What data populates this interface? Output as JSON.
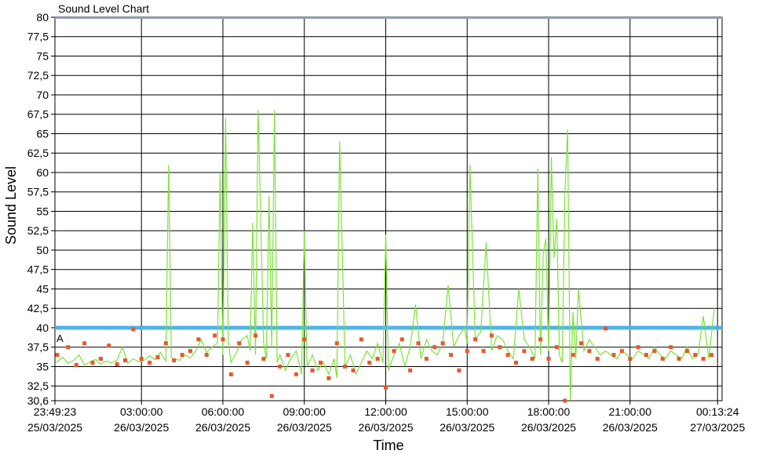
{
  "chart_data": {
    "type": "line",
    "title": "Sound Level Chart",
    "xlabel": "Time",
    "ylabel": "Sound Level",
    "ylim": [
      30.6,
      80
    ],
    "yticks": [
      80,
      77.5,
      75,
      72.5,
      70,
      67.5,
      65,
      62.5,
      60,
      57.5,
      55,
      52.5,
      50,
      47.5,
      45,
      42.5,
      40,
      37.5,
      35,
      32.5,
      30.6
    ],
    "ytick_labels": [
      "80",
      "77,5",
      "75",
      "72,5",
      "70",
      "67,5",
      "65",
      "62,5",
      "60",
      "57,5",
      "55",
      "52,5",
      "50",
      "47,5",
      "45",
      "42,5",
      "40",
      "37,5",
      "35",
      "32,5",
      "30,6"
    ],
    "xlim_hours": [
      -0.18694,
      24.39
    ],
    "xticks": [
      {
        "h": -0.18694,
        "time": "23:49:23",
        "date": "25/03/2025"
      },
      {
        "h": 3,
        "time": "03:00:00",
        "date": "26/03/2025"
      },
      {
        "h": 6,
        "time": "06:00:00",
        "date": "26/03/2025"
      },
      {
        "h": 9,
        "time": "09:00:00",
        "date": "26/03/2025"
      },
      {
        "h": 12,
        "time": "12:00:00",
        "date": "26/03/2025"
      },
      {
        "h": 15,
        "time": "15:00:00",
        "date": "26/03/2025"
      },
      {
        "h": 18,
        "time": "18:00:00",
        "date": "26/03/2025"
      },
      {
        "h": 21,
        "time": "21:00:00",
        "date": "26/03/2025"
      },
      {
        "h": 24.2233,
        "time": "00:13:24",
        "date": "27/03/2025"
      }
    ],
    "threshold": {
      "value": 40,
      "color": "#4fb3ea"
    },
    "marker_label": "A",
    "grid": true,
    "series": [
      {
        "color": "#7de33a",
        "x_hours": [
          -0.15,
          0.1,
          0.3,
          0.5,
          0.7,
          0.9,
          1.1,
          1.3,
          1.5,
          1.7,
          1.9,
          2.1,
          2.3,
          2.5,
          2.7,
          2.9,
          3.1,
          3.3,
          3.5,
          3.7,
          3.9,
          4.0,
          4.1,
          4.2,
          4.4,
          4.6,
          4.8,
          5.0,
          5.2,
          5.4,
          5.6,
          5.8,
          5.9,
          6.0,
          6.1,
          6.2,
          6.3,
          6.5,
          6.7,
          6.9,
          7.0,
          7.1,
          7.2,
          7.3,
          7.5,
          7.6,
          7.7,
          7.8,
          7.9,
          8.0,
          8.1,
          8.3,
          8.5,
          8.7,
          8.9,
          9.0,
          9.1,
          9.3,
          9.5,
          9.7,
          9.9,
          10.1,
          10.2,
          10.3,
          10.5,
          10.7,
          10.9,
          11.1,
          11.3,
          11.5,
          11.7,
          11.9,
          12.0,
          12.1,
          12.3,
          12.5,
          12.7,
          12.9,
          13.1,
          13.3,
          13.5,
          13.7,
          13.9,
          14.1,
          14.3,
          14.5,
          14.7,
          14.9,
          15.0,
          15.1,
          15.3,
          15.5,
          15.7,
          15.9,
          16.1,
          16.3,
          16.5,
          16.7,
          16.9,
          17.1,
          17.3,
          17.5,
          17.6,
          17.7,
          17.8,
          17.9,
          18.0,
          18.1,
          18.2,
          18.3,
          18.4,
          18.5,
          18.6,
          18.7,
          18.8,
          18.9,
          19.0,
          19.1,
          19.3,
          19.5,
          19.7,
          19.9,
          20.1,
          20.3,
          20.5,
          20.7,
          20.9,
          21.1,
          21.3,
          21.5,
          21.7,
          21.9,
          22.1,
          22.3,
          22.5,
          22.7,
          22.9,
          23.1,
          23.3,
          23.5,
          23.7,
          23.9,
          24.1,
          24.2
        ],
        "values": [
          35.5,
          36.2,
          35.4,
          35.8,
          36.5,
          35.2,
          35.6,
          35.9,
          35.3,
          35.7,
          35.5,
          35.8,
          37.5,
          35.4,
          36.0,
          35.6,
          35.8,
          36.4,
          35.9,
          36.8,
          35.7,
          61.0,
          36.2,
          36.0,
          35.8,
          36.5,
          36.1,
          37.0,
          38.5,
          36.8,
          37.5,
          38.0,
          60.0,
          36.5,
          67.0,
          38.2,
          35.5,
          36.8,
          38.5,
          39.0,
          37.0,
          53.5,
          36.5,
          68.0,
          38.0,
          36.0,
          57.0,
          37.5,
          68.0,
          35.5,
          36.5,
          34.5,
          36.0,
          37.0,
          34.0,
          52.5,
          35.0,
          36.5,
          34.5,
          35.5,
          34.0,
          36.0,
          33.5,
          64.0,
          35.0,
          36.5,
          34.0,
          35.5,
          37.0,
          36.0,
          38.0,
          35.5,
          52.0,
          34.5,
          36.5,
          38.0,
          35.0,
          37.5,
          43.0,
          36.0,
          38.5,
          37.0,
          36.5,
          38.0,
          45.5,
          37.5,
          39.0,
          40.0,
          38.0,
          61.0,
          38.5,
          39.5,
          51.0,
          37.0,
          39.0,
          38.5,
          37.0,
          36.0,
          45.0,
          38.5,
          37.5,
          36.0,
          60.5,
          36.5,
          49.5,
          51.5,
          37.0,
          62.0,
          49.0,
          54.0,
          36.5,
          35.5,
          57.5,
          65.5,
          30.6,
          42.0,
          36.0,
          45.0,
          37.0,
          38.5,
          37.5,
          36.5,
          37.0,
          36.5,
          36.0,
          37.0,
          36.5,
          36.0,
          37.0,
          36.5,
          36.0,
          37.5,
          36.5,
          36.0,
          37.0,
          36.5,
          36.0,
          37.5,
          36.0,
          36.5,
          41.5,
          36.0,
          42.5
        ]
      },
      {
        "color": "#e8572b",
        "x_hours": [
          -0.1,
          0.3,
          0.6,
          0.9,
          1.2,
          1.5,
          1.8,
          2.1,
          2.4,
          2.7,
          3.0,
          3.3,
          3.6,
          3.9,
          4.2,
          4.5,
          4.8,
          5.1,
          5.4,
          5.7,
          6.0,
          6.3,
          6.6,
          6.9,
          7.2,
          7.5,
          7.8,
          8.1,
          8.4,
          8.7,
          9.0,
          9.3,
          9.6,
          9.9,
          10.2,
          10.5,
          10.8,
          11.1,
          11.4,
          11.7,
          12.0,
          12.3,
          12.6,
          12.9,
          13.2,
          13.5,
          13.8,
          14.1,
          14.4,
          14.7,
          15.0,
          15.3,
          15.6,
          15.9,
          16.2,
          16.5,
          16.8,
          17.1,
          17.4,
          17.7,
          18.0,
          18.3,
          18.6,
          18.9,
          19.2,
          19.5,
          19.8,
          20.1,
          20.4,
          20.7,
          21.0,
          21.3,
          21.6,
          21.9,
          22.2,
          22.5,
          22.8,
          23.1,
          23.4,
          23.7,
          24.0
        ],
        "values": [
          36.5,
          37.5,
          35.2,
          38.0,
          35.5,
          36.0,
          37.7,
          35.3,
          35.8,
          39.8,
          36.0,
          35.5,
          36.2,
          38.0,
          35.8,
          36.5,
          37.0,
          38.5,
          36.5,
          39.0,
          38.5,
          34.0,
          38.0,
          35.5,
          39.0,
          36.0,
          31.2,
          35.0,
          36.5,
          34.0,
          38.5,
          34.5,
          35.5,
          33.5,
          38.0,
          35.0,
          34.5,
          38.5,
          35.5,
          36.0,
          32.3,
          37.0,
          38.5,
          34.5,
          38.0,
          36.0,
          37.5,
          38.0,
          36.5,
          34.5,
          37.0,
          38.5,
          37.0,
          39.0,
          37.5,
          36.5,
          35.5,
          37.0,
          36.0,
          38.5,
          36.0,
          37.5,
          30.6,
          36.5,
          38.0,
          37.0,
          36.0,
          39.9,
          36.5,
          37.0,
          36.0,
          37.5,
          36.5,
          37.0,
          36.0,
          37.5,
          36.0,
          37.0,
          36.5,
          36.0,
          36.5
        ]
      }
    ]
  }
}
